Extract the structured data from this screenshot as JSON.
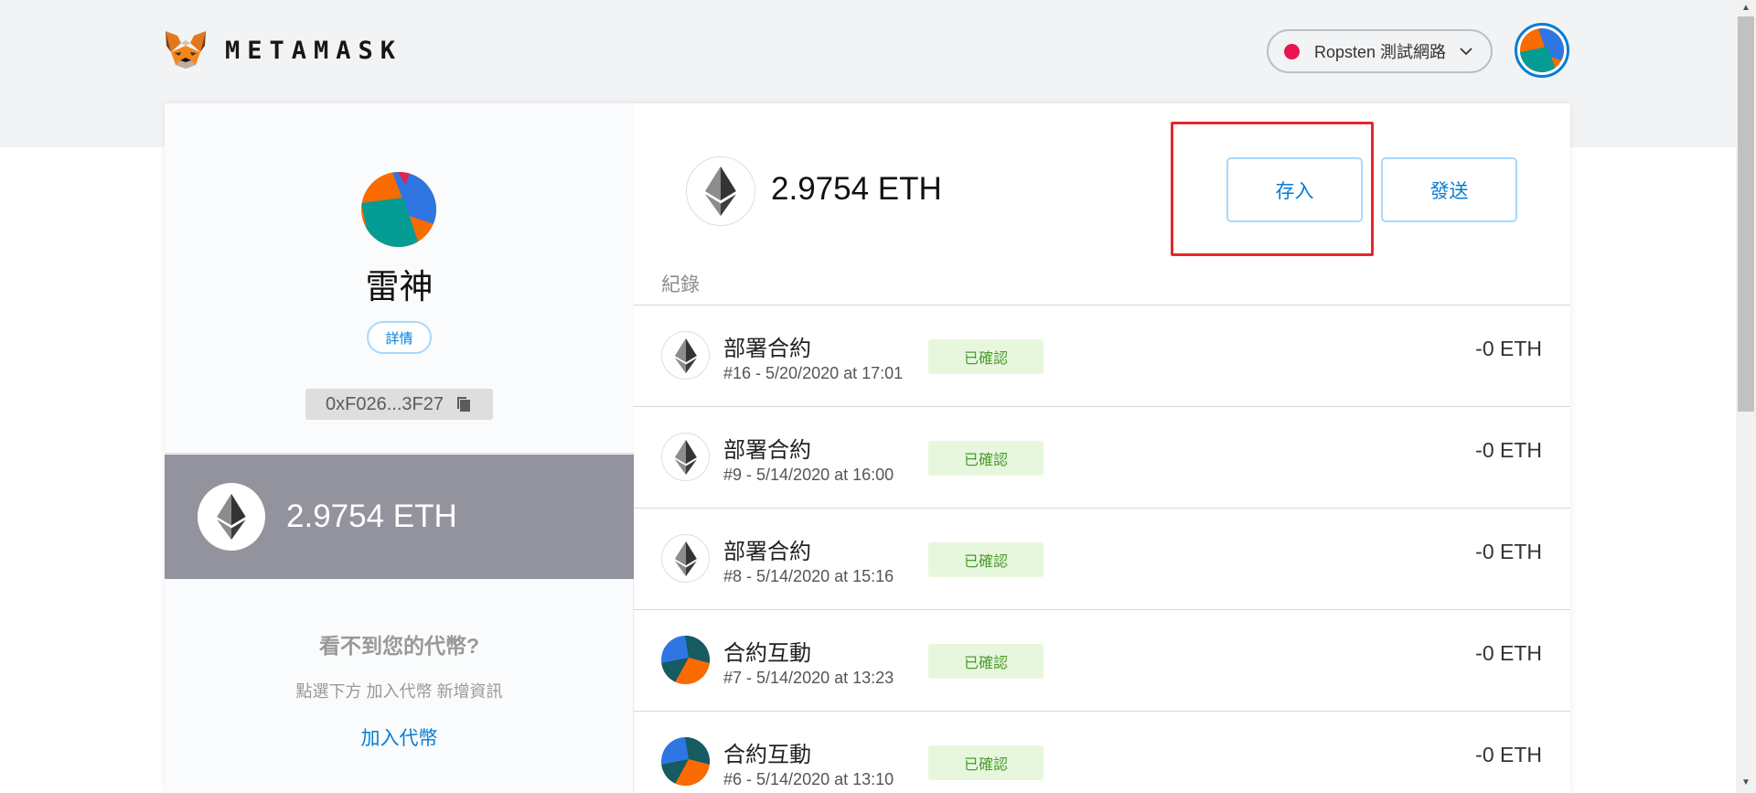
{
  "header": {
    "wordmark": "METAMASK",
    "network_label": "Ropsten 測試網路",
    "network_dot_color": "#e91550",
    "accent_color": "#037dd6"
  },
  "account": {
    "name": "雷神",
    "details_label": "詳情",
    "address": "0xF026...3F27",
    "balance": "2.9754 ETH"
  },
  "tokens": {
    "heading": "看不到您的代幣?",
    "hint": "點選下方 加入代幣 新增資訊",
    "add_label": "加入代幣"
  },
  "main": {
    "balance": "2.9754 ETH",
    "deposit_label": "存入",
    "send_label": "發送",
    "history_label": "紀錄",
    "highlight_color": "#e8262b"
  },
  "transactions": [
    {
      "icon": "eth",
      "title": "部署合約",
      "sub": "#16 - 5/20/2020 at 17:01",
      "status": "已確認",
      "amount": "-0 ETH"
    },
    {
      "icon": "eth",
      "title": "部署合約",
      "sub": "#9 - 5/14/2020 at 16:00",
      "status": "已確認",
      "amount": "-0 ETH"
    },
    {
      "icon": "eth",
      "title": "部署合約",
      "sub": "#8 - 5/14/2020 at 15:16",
      "status": "已確認",
      "amount": "-0 ETH"
    },
    {
      "icon": "pie",
      "title": "合約互動",
      "sub": "#7 - 5/14/2020 at 13:23",
      "status": "已確認",
      "amount": "-0 ETH"
    },
    {
      "icon": "pie",
      "title": "合約互動",
      "sub": "#6 - 5/14/2020 at 13:10",
      "status": "已確認",
      "amount": "-0 ETH"
    }
  ]
}
